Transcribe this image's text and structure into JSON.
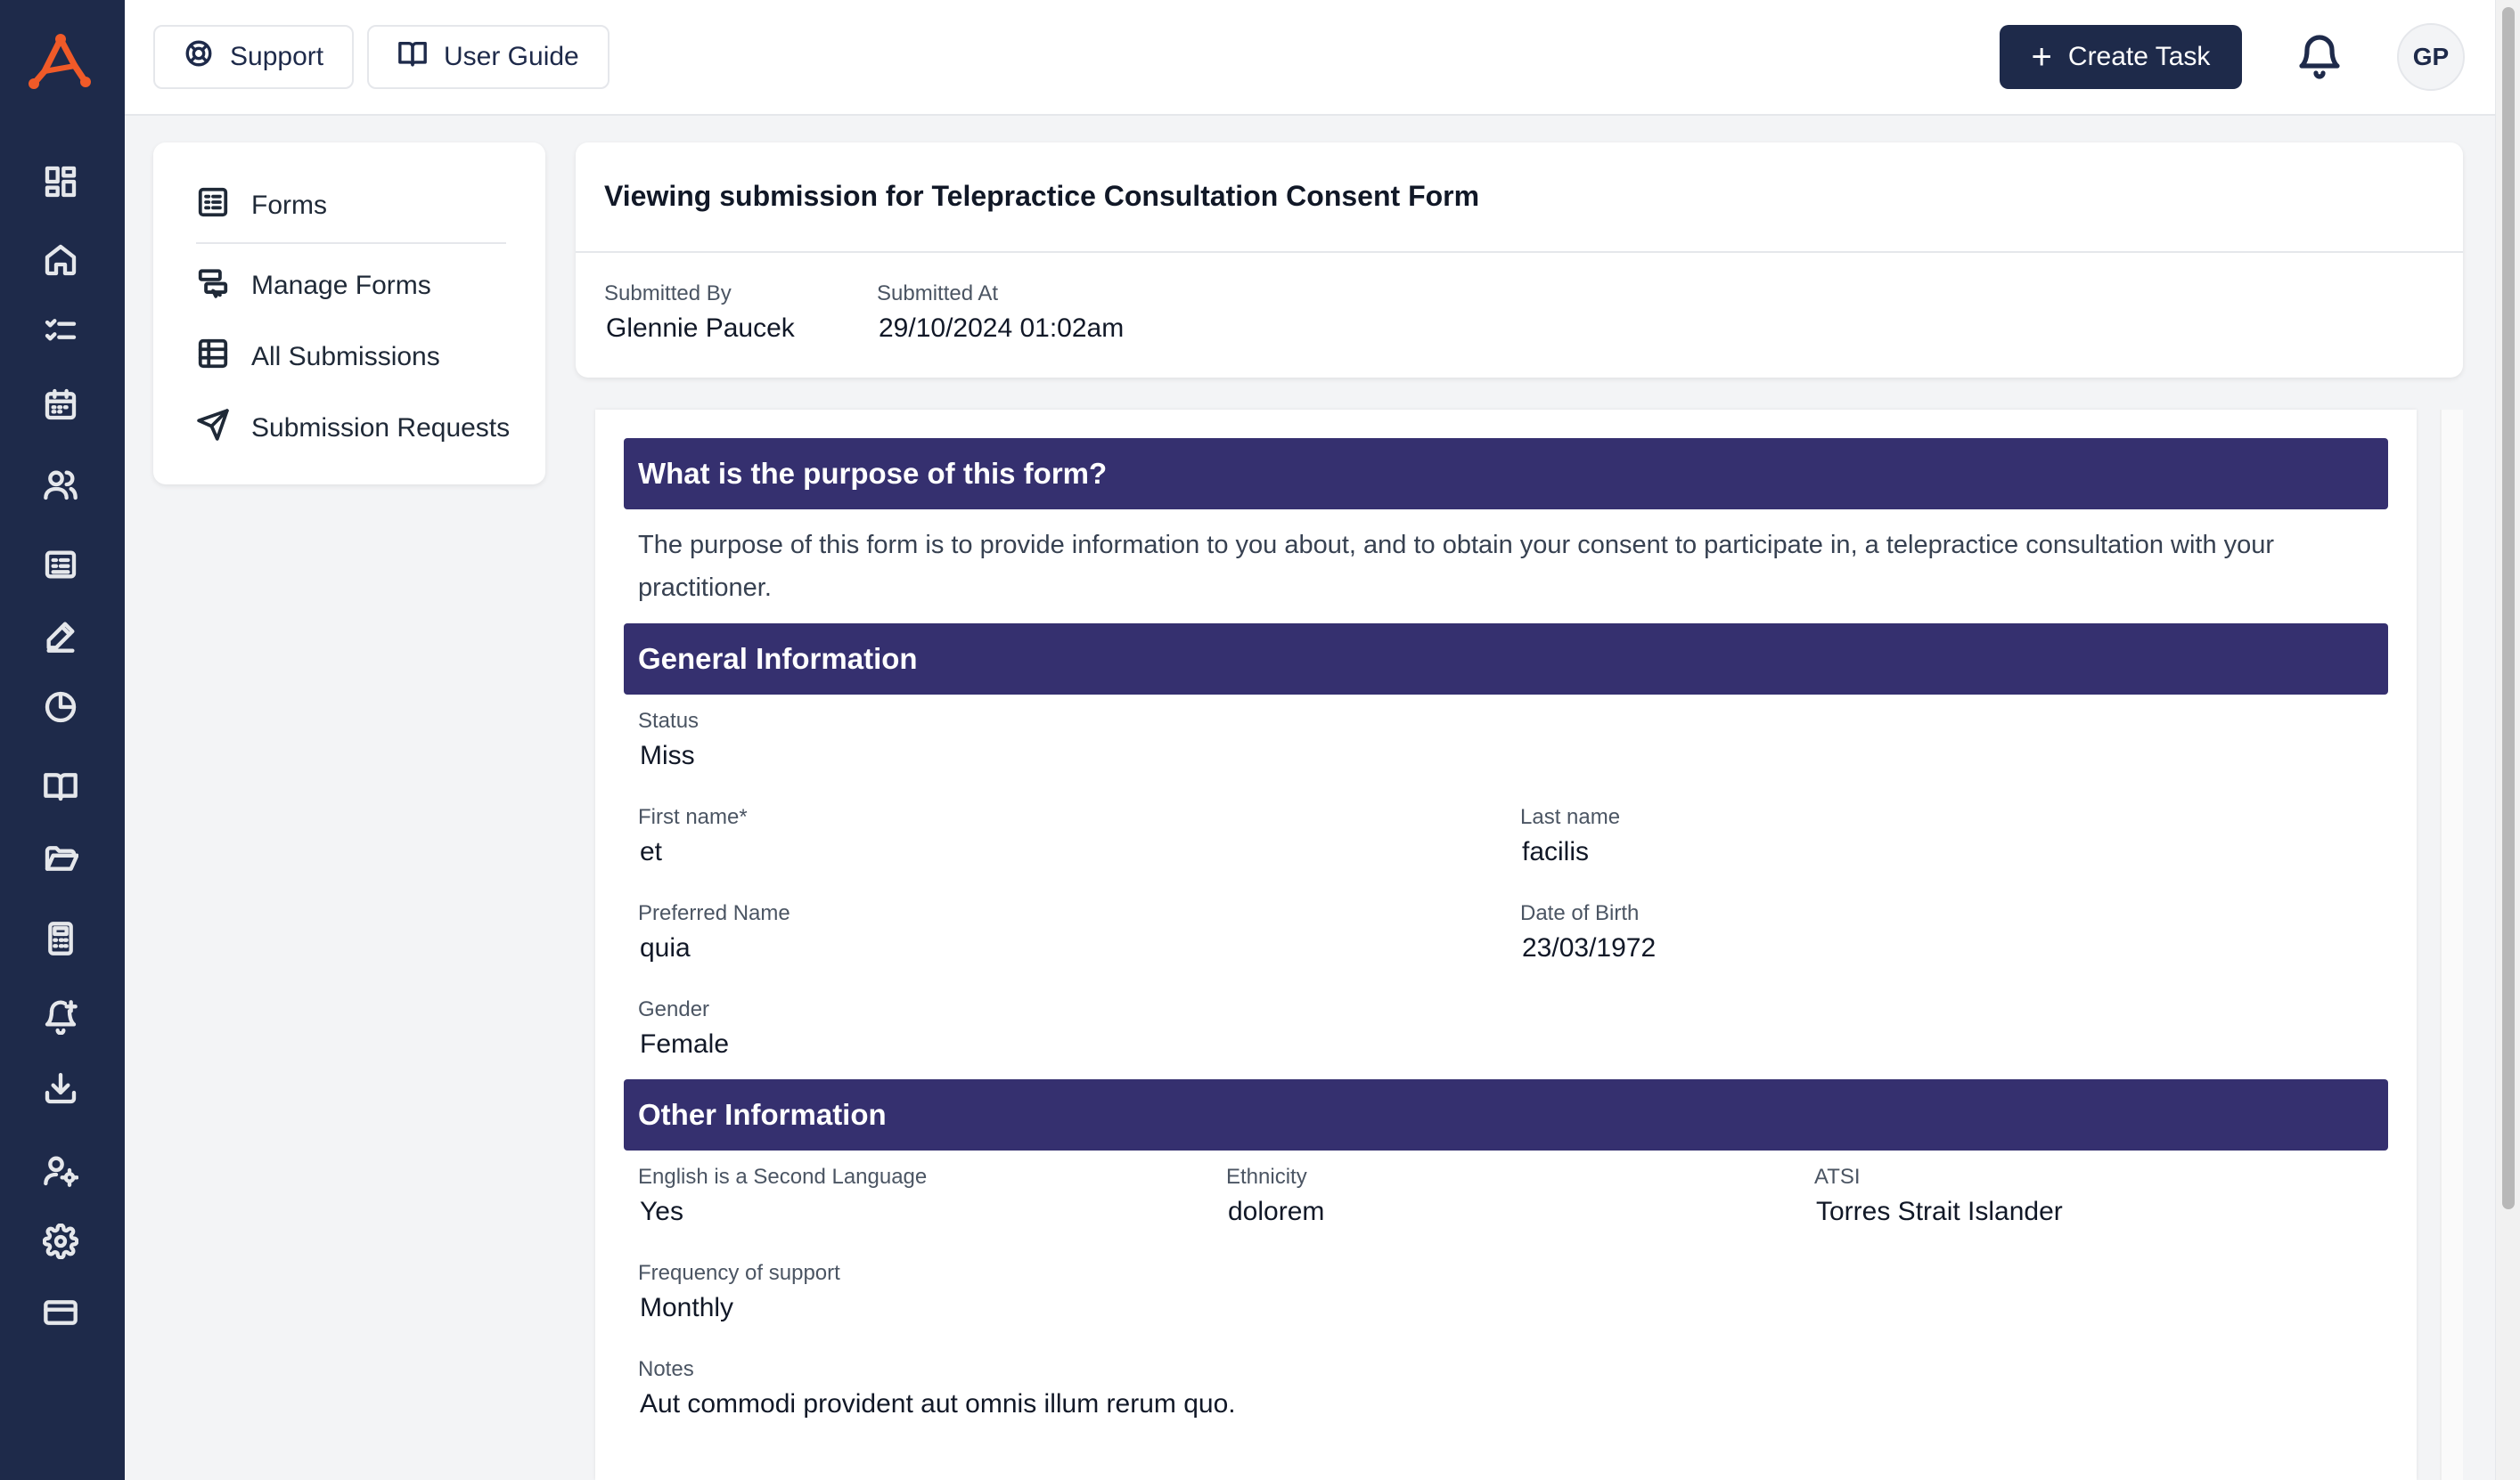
{
  "topbar": {
    "support_label": "Support",
    "guide_label": "User Guide",
    "create_label": "Create Task",
    "avatar_initials": "GP"
  },
  "rail_icons": [
    "dashboard-icon",
    "home-icon",
    "tasks-icon",
    "calendar-icon",
    "users-icon",
    "forms-icon",
    "signature-icon",
    "reports-icon",
    "book-icon",
    "folder-icon",
    "calculator-icon",
    "alert-icon",
    "download-icon",
    "user-settings-icon",
    "settings-icon",
    "billing-icon"
  ],
  "side_menu": {
    "forms": "Forms",
    "manage_forms": "Manage Forms",
    "all_submissions": "All Submissions",
    "submission_requests": "Submission Requests"
  },
  "submission": {
    "title": "Viewing submission for Telepractice Consultation Consent Form",
    "submitted_by_label": "Submitted By",
    "submitted_by": "Glennie Paucek",
    "submitted_at_label": "Submitted At",
    "submitted_at": "29/10/2024 01:02am"
  },
  "form": {
    "purpose_heading": "What is the purpose of this form?",
    "purpose_text": "The purpose of this form is to provide information to you about, and to obtain your consent to participate in, a telepractice consultation with your practitioner.",
    "general_heading": "General Information",
    "status_label": "Status",
    "status": "Miss",
    "first_name_label": "First name*",
    "first_name": "et",
    "last_name_label": "Last name",
    "last_name": "facilis",
    "preferred_name_label": "Preferred Name",
    "preferred_name": "quia",
    "dob_label": "Date of Birth",
    "dob": "23/03/1972",
    "gender_label": "Gender",
    "gender": "Female",
    "other_heading": "Other Information",
    "esl_label": "English is a Second Language",
    "esl": "Yes",
    "ethnicity_label": "Ethnicity",
    "ethnicity": "dolorem",
    "atsi_label": "ATSI",
    "atsi": "Torres Strait Islander",
    "frequency_label": "Frequency of support",
    "frequency": "Monthly",
    "notes_label": "Notes",
    "notes": "Aut commodi provident aut omnis illum rerum quo."
  },
  "colors": {
    "rail": "#1e2a4a",
    "section_header": "#35306f",
    "logo_accent": "#f05a28"
  }
}
